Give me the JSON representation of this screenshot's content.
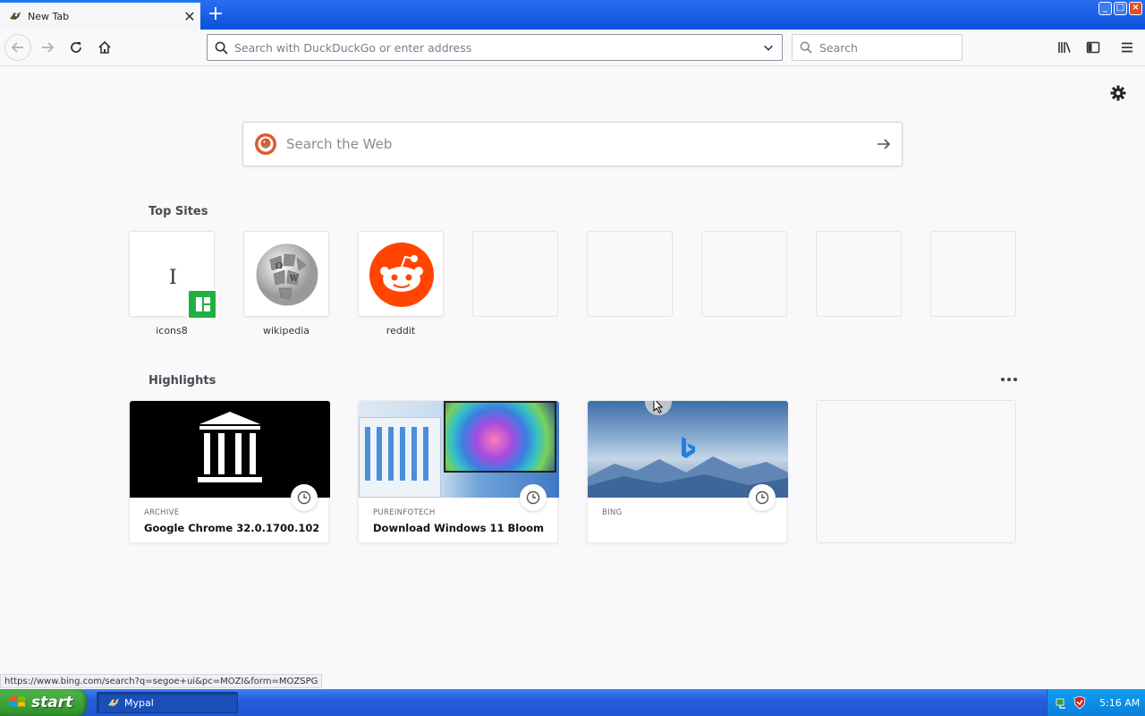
{
  "tab": {
    "title": "New Tab",
    "close": "✕",
    "new": "+"
  },
  "window": {
    "min": "_",
    "max": "□",
    "close": "×"
  },
  "toolbar": {
    "url_placeholder": "Search with DuckDuckGo or enter address",
    "search_placeholder": "Search"
  },
  "content": {
    "web_search_placeholder": "Search the Web",
    "topsites_title": "Top Sites",
    "highlights_title": "Highlights",
    "top_sites": [
      {
        "label": "icons8"
      },
      {
        "label": "wikipedia"
      },
      {
        "label": "reddit"
      }
    ],
    "highlights": [
      {
        "source": "ARCHIVE",
        "title": "Google Chrome 32.0.1700.102 : ..."
      },
      {
        "source": "PUREINFOTECH",
        "title": "Download Windows 11 Bloom Co..."
      },
      {
        "source": "BING",
        "title": ""
      }
    ]
  },
  "status_url": "https://www.bing.com/search?q=segoe+ui&pc=MOZI&form=MOZSPG",
  "taskbar": {
    "start": "start",
    "task": "Mypal",
    "time": "5:16 AM"
  },
  "colors": {
    "tabstrip": "#0a52d8",
    "taskbar": "#245edb",
    "reddit": "#ff4500",
    "icons8": "#1fb141"
  }
}
